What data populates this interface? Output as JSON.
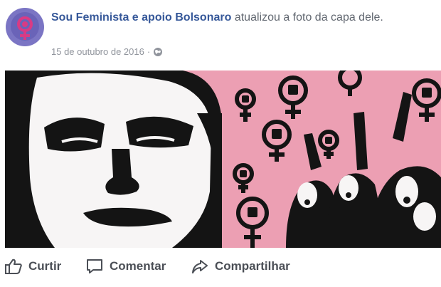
{
  "post": {
    "author": "Sou Feminista e apoio Bolsonaro",
    "action_text": "atualizou a foto da capa dele.",
    "date": "15 de outubro de 2016",
    "separator": "·",
    "audience_icon": "globe-icon"
  },
  "actions": {
    "like_label": "Curtir",
    "comment_label": "Comentar",
    "share_label": "Compartilhar"
  },
  "colors": {
    "cover_pink": "#ec9fb3",
    "link_blue": "#365899",
    "avatar_purple": "#7b75c4"
  }
}
